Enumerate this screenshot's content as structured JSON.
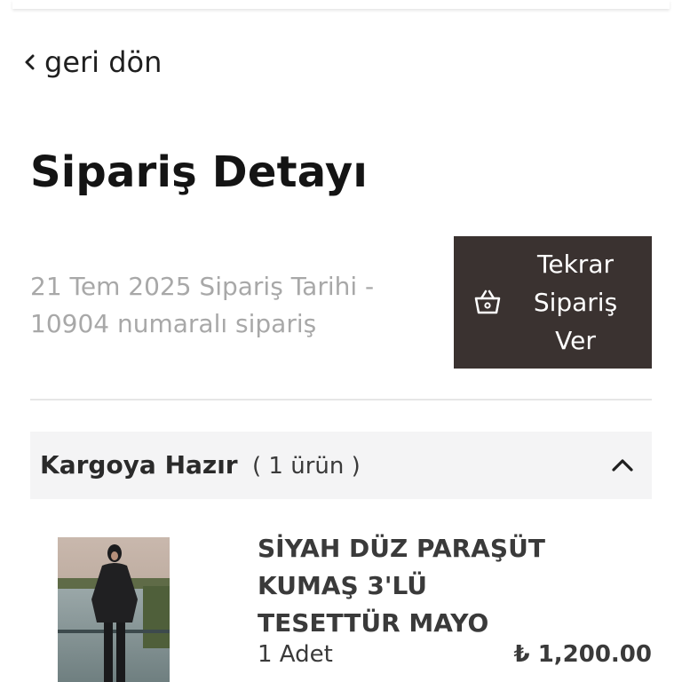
{
  "nav": {
    "back_label": "geri dön"
  },
  "page": {
    "title": "Sipariş Detayı"
  },
  "order": {
    "meta_line1": "21 Tem 2025 Sipariş Tarihi -",
    "meta_line2": "10904 numaralı sipariş"
  },
  "reorder_button": {
    "label_line1": "Tekrar",
    "label_line2": "Sipariş",
    "label_line3": "Ver",
    "icon": "basket-icon",
    "color": "#3a3230"
  },
  "shipment": {
    "status": "Kargoya Hazır",
    "item_count": "( 1 ürün )",
    "expanded": true,
    "toggle_icon": "chevron-up-icon"
  },
  "items": [
    {
      "name": "SİYAH DÜZ PARAŞÜT KUMAŞ 3'LÜ TESETTÜR MAYO",
      "quantity": "1 Adet",
      "price": "₺ 1,200.00"
    }
  ]
}
